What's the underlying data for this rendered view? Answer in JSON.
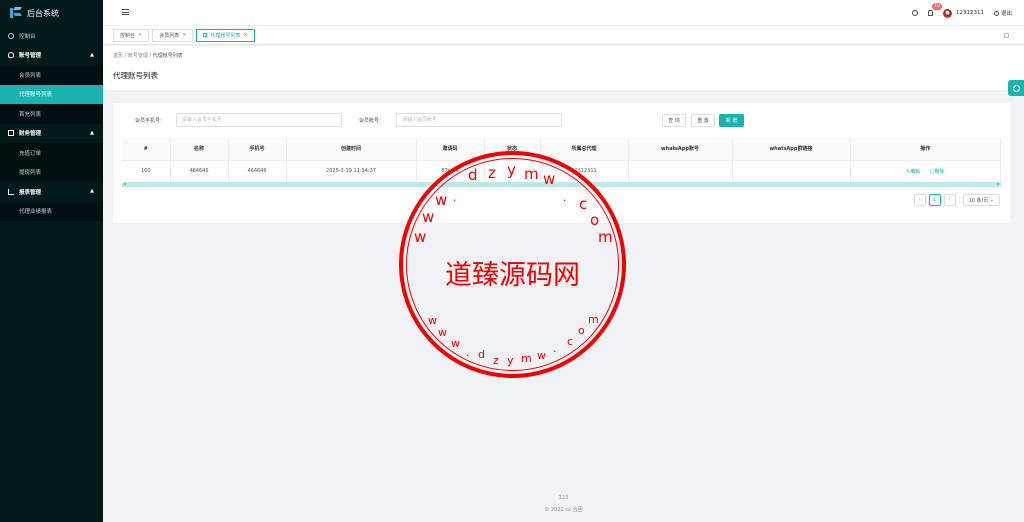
{
  "app": {
    "title": "后台系统"
  },
  "sidebar": {
    "dashboard": "控制台",
    "groups": [
      {
        "label": "账号管理",
        "items": [
          {
            "label": "会员列表"
          },
          {
            "label": "代理账号列表",
            "active": true
          },
          {
            "label": "首充列表"
          }
        ]
      },
      {
        "label": "财务管理",
        "items": [
          {
            "label": "充值订单"
          },
          {
            "label": "提现列表"
          }
        ]
      },
      {
        "label": "报表管理",
        "items": [
          {
            "label": "代理业绩报表"
          }
        ]
      }
    ]
  },
  "topbar": {
    "badge": "10",
    "username": "12312311",
    "settings": "退出"
  },
  "tabs": [
    {
      "label": "控制台"
    },
    {
      "label": "会员列表"
    },
    {
      "label": "代理账号列表",
      "active": true
    }
  ],
  "breadcrumb": {
    "home": "首页",
    "parent": "账号管理",
    "current": "代理账号列表"
  },
  "page": {
    "title": "代理账号列表"
  },
  "filters": {
    "phone_label": "会员手机号:",
    "phone_placeholder": "请输入会员手机号",
    "account_label": "会员账号:",
    "account_placeholder": "请输入会员账号",
    "search": "查 询",
    "reset": "重 置",
    "add": "新 增"
  },
  "table": {
    "columns": [
      "#",
      "名称",
      "手机号",
      "创建时间",
      "邀请码",
      "状态",
      "所属总代理",
      "whatsApp账号",
      "whatsApp群链接",
      "操作"
    ],
    "rows": [
      {
        "id": "160",
        "name": "464646",
        "phone": "464646",
        "created": "2025-3-19 11:34:37",
        "invite": "87iu84",
        "status": "",
        "agent": "12312311",
        "wa_account": "",
        "wa_link": "",
        "edit": "编辑",
        "delete": "删除"
      }
    ]
  },
  "pagination": {
    "current": "1",
    "page_size": "10 条/页"
  },
  "footer": {
    "line1": "123",
    "line2": "2021 cx 合团"
  },
  "watermark": {
    "center": "道臻源码网",
    "top_ring": "www.dzym.com",
    "bottom_ring": "www.dzym.com"
  },
  "colors": {
    "accent": "#1ab3b0",
    "sidebar": "#001a1a",
    "stamp": "#e00000"
  }
}
